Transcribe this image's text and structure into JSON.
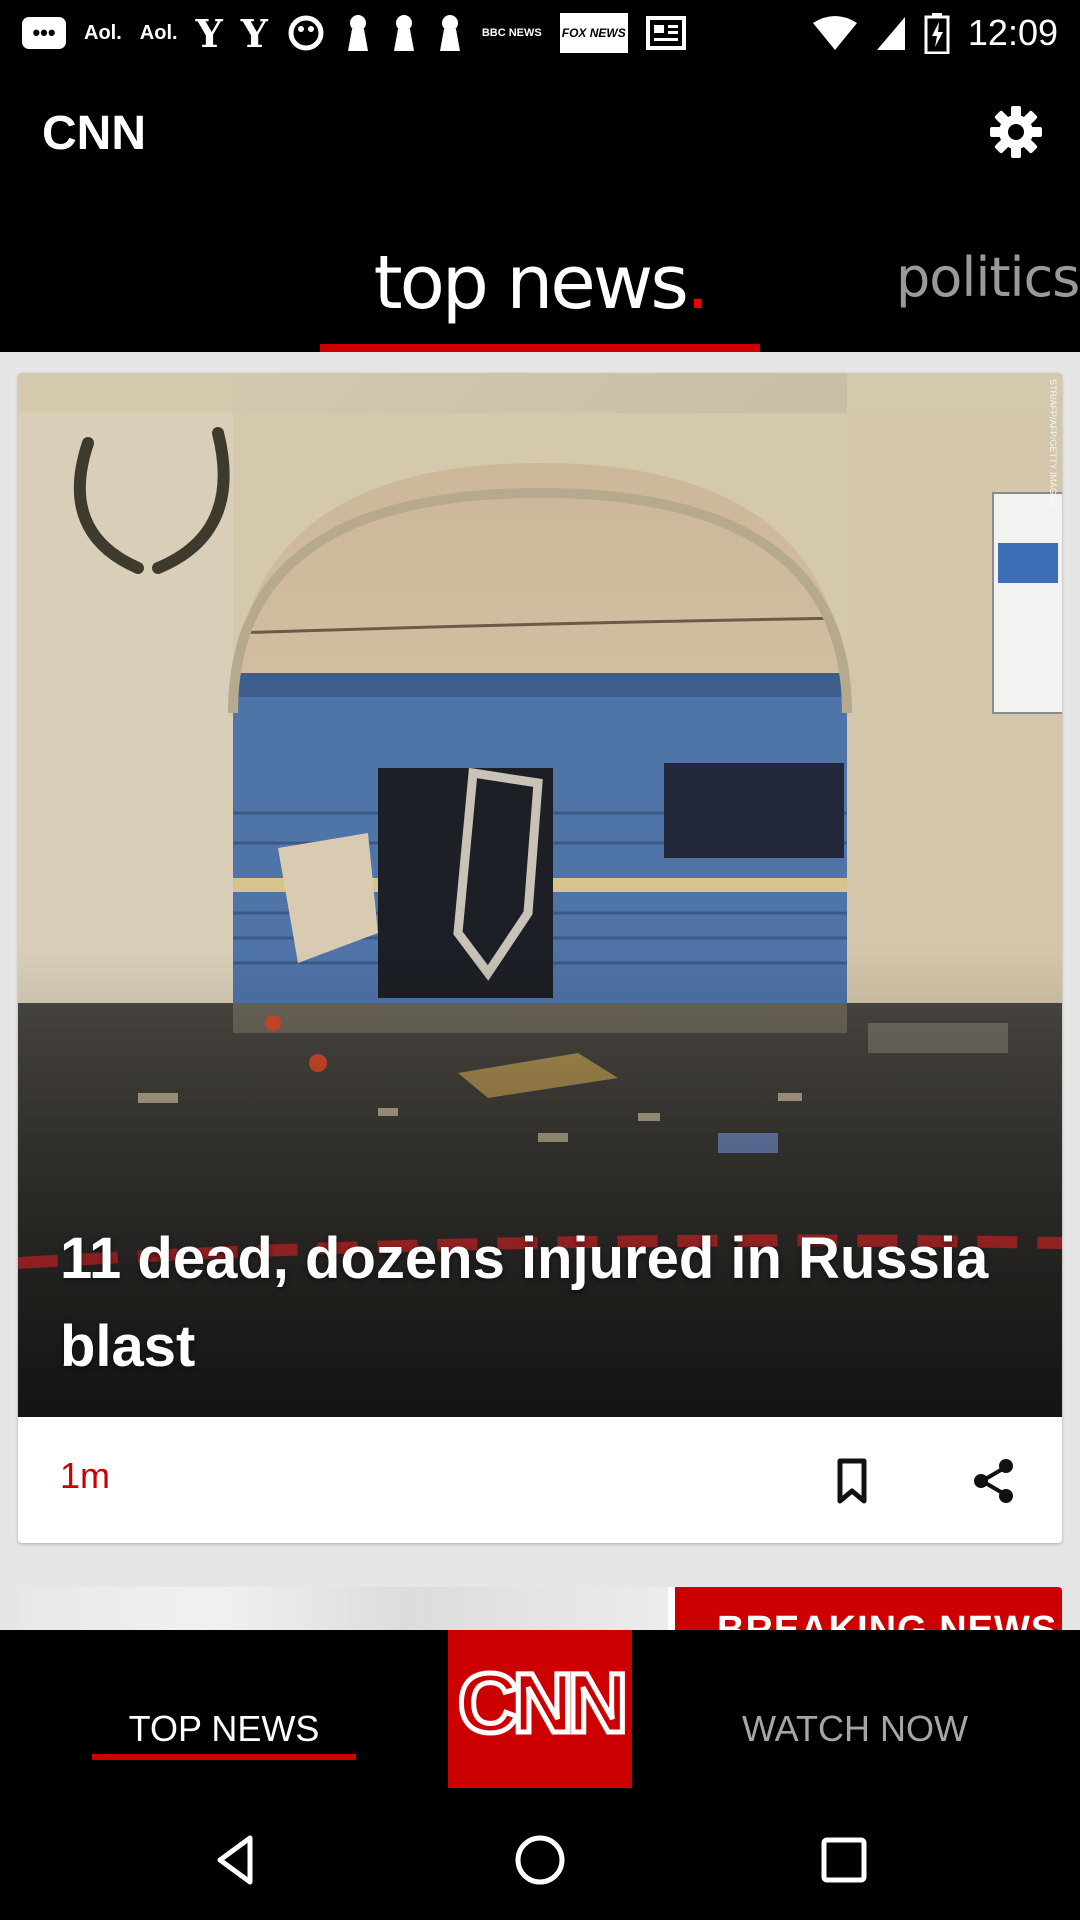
{
  "status_bar": {
    "time": "12:09",
    "notification_icons": [
      "more-icon",
      "aol-icon",
      "aol-icon",
      "yahoo-icon",
      "yahoo-icon",
      "yahoo-messenger-icon",
      "pin-icon",
      "pin-icon",
      "pin-icon",
      "bbc-news-icon",
      "fox-news-icon",
      "news-icon"
    ],
    "aol_label": "Aol.",
    "yahoo_label": "Y",
    "bbc_label": "BBC NEWS",
    "fox_label": "FOX NEWS"
  },
  "header": {
    "title": "CNN"
  },
  "section_tabs": {
    "active": "top news",
    "active_dot": ".",
    "next": "politics"
  },
  "feed": {
    "cards": [
      {
        "headline": "11 dead, dozens injured in Russia blast",
        "timestamp": "1m",
        "image_credit": "STR/AFP/AFP/GETTY IMAGES"
      }
    ],
    "next_card": {
      "badge": "BREAKING NEWS"
    }
  },
  "bottom_nav": {
    "top_news": "TOP NEWS",
    "logo": "CNN",
    "watch_now": "WATCH NOW"
  },
  "colors": {
    "accent": "#cc0000",
    "background": "#000000",
    "feed_background": "#e6e6e6",
    "inactive_tab": "#9a9a9a"
  }
}
